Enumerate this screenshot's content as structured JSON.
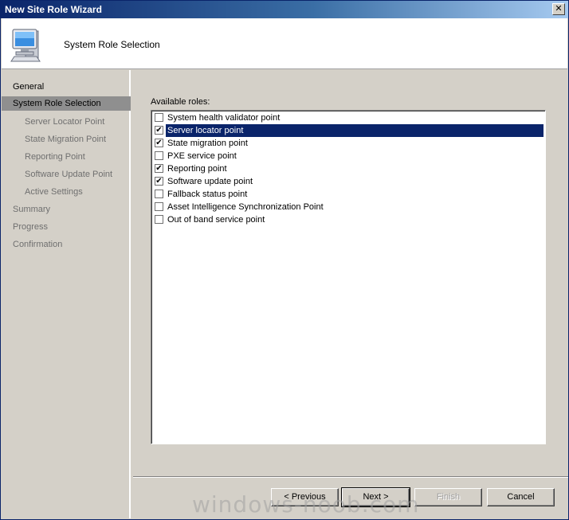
{
  "window": {
    "title": "New Site Role Wizard",
    "close_glyph": "✕"
  },
  "header": {
    "title": "System Role Selection",
    "icon": "computer-monitor-icon"
  },
  "nav": {
    "items": [
      {
        "label": "General",
        "state": "normal"
      },
      {
        "label": "System Role Selection",
        "state": "active"
      },
      {
        "label": "Server Locator Point",
        "state": "sub"
      },
      {
        "label": "State Migration Point",
        "state": "sub"
      },
      {
        "label": "Reporting Point",
        "state": "sub"
      },
      {
        "label": "Software Update Point",
        "state": "sub"
      },
      {
        "label": "Active Settings",
        "state": "sub"
      },
      {
        "label": "Summary",
        "state": "gray"
      },
      {
        "label": "Progress",
        "state": "gray"
      },
      {
        "label": "Confirmation",
        "state": "gray"
      }
    ]
  },
  "roles": {
    "label": "Available roles:",
    "check_glyph": "✔",
    "items": [
      {
        "label": "System health validator point",
        "checked": false,
        "selected": false
      },
      {
        "label": "Server locator point",
        "checked": true,
        "selected": true
      },
      {
        "label": "State migration point",
        "checked": true,
        "selected": false
      },
      {
        "label": "PXE service point",
        "checked": false,
        "selected": false
      },
      {
        "label": "Reporting point",
        "checked": true,
        "selected": false
      },
      {
        "label": "Software update point",
        "checked": true,
        "selected": false
      },
      {
        "label": "Fallback status point",
        "checked": false,
        "selected": false
      },
      {
        "label": "Asset Intelligence Synchronization Point",
        "checked": false,
        "selected": false
      },
      {
        "label": "Out of band service point",
        "checked": false,
        "selected": false
      }
    ]
  },
  "buttons": {
    "previous": "< Previous",
    "next": "Next >",
    "finish": "Finish",
    "cancel": "Cancel"
  },
  "watermark": "windows-noob.com",
  "colors": {
    "selection": "#0a246a",
    "titlebar": "#0a246a",
    "nav_active": "#8f8f8f"
  }
}
